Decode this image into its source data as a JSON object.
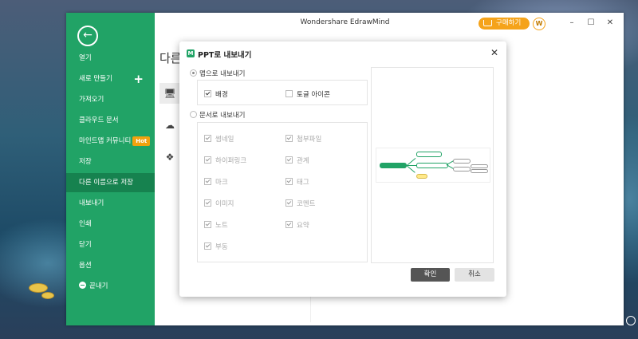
{
  "app": {
    "title": "Wondershare EdrawMind",
    "buy_label": "구매하기",
    "avatar_letter": "W",
    "win_minimize": "–",
    "win_maximize": "☐",
    "win_close": "✕",
    "content_heading": "다른"
  },
  "sidebar": {
    "items": [
      {
        "label": "열기"
      },
      {
        "label": "새로 만들기"
      },
      {
        "label": "가져오기"
      },
      {
        "label": "클라우드 문서"
      },
      {
        "label": "마인드맵 커뮤니티",
        "badge": "Hot"
      },
      {
        "label": "저장"
      },
      {
        "label": "다른 이름으로 저장"
      },
      {
        "label": "내보내기"
      },
      {
        "label": "인쇄"
      },
      {
        "label": "닫기"
      },
      {
        "label": "옵션"
      },
      {
        "label": "끝내기"
      }
    ],
    "plus_label": "+"
  },
  "dialog": {
    "logo": "M",
    "title": "PPT로 내보내기",
    "close": "✕",
    "map_export": {
      "label": "맵으로 내보내기",
      "selected": true,
      "options": [
        {
          "label": "배경",
          "checked": true
        },
        {
          "label": "토글 아이콘",
          "checked": false
        }
      ]
    },
    "doc_export": {
      "label": "문서로 내보내기",
      "selected": false,
      "options": [
        {
          "label": "썸네일",
          "checked": true
        },
        {
          "label": "첨부파일",
          "checked": true
        },
        {
          "label": "하이퍼링크",
          "checked": true
        },
        {
          "label": "관계",
          "checked": true
        },
        {
          "label": "마크",
          "checked": true
        },
        {
          "label": "태그",
          "checked": true
        },
        {
          "label": "이미지",
          "checked": true
        },
        {
          "label": "코멘트",
          "checked": true
        },
        {
          "label": "노트",
          "checked": true
        },
        {
          "label": "요약",
          "checked": true
        },
        {
          "label": "부동",
          "checked": true
        }
      ]
    },
    "ok_label": "확인",
    "cancel_label": "취소"
  },
  "colors": {
    "brand_green": "#21a366",
    "accent_orange": "#f5a31a",
    "ok_button": "#555555"
  }
}
